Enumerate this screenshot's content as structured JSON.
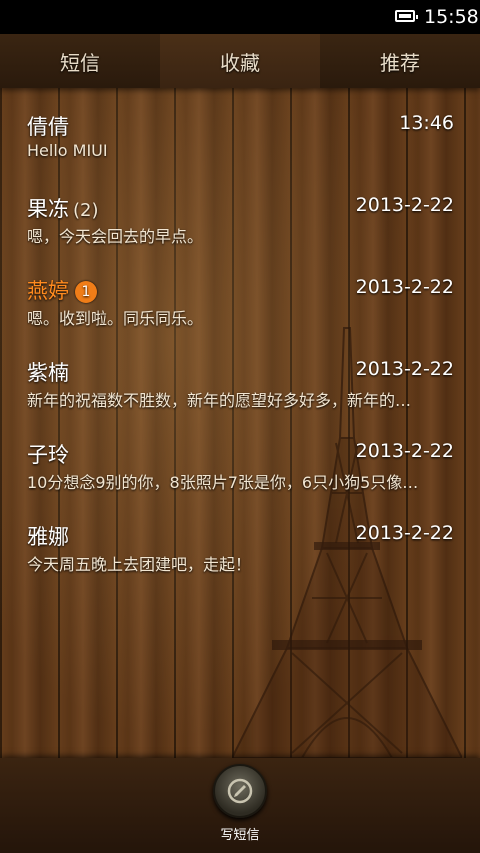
{
  "status_bar": {
    "time": "15:58"
  },
  "tabs": [
    {
      "label": "短信"
    },
    {
      "label": "收藏"
    },
    {
      "label": "推荐"
    }
  ],
  "messages": [
    {
      "name": "倩倩",
      "count": "",
      "unread_badge": "",
      "time": "13:46",
      "preview": "Hello MIUI"
    },
    {
      "name": "果冻",
      "count": "(2)",
      "unread_badge": "",
      "time": "2013-2-22",
      "preview": "嗯，今天会回去的早点。"
    },
    {
      "name": "燕婷",
      "count": "",
      "unread_badge": "1",
      "time": "2013-2-22",
      "preview": "嗯。收到啦。同乐同乐。"
    },
    {
      "name": "紫楠",
      "count": "",
      "unread_badge": "",
      "time": "2013-2-22",
      "preview": "新年的祝福数不胜数，新年的愿望好多好多，新年的…"
    },
    {
      "name": "子玲",
      "count": "",
      "unread_badge": "",
      "time": "2013-2-22",
      "preview": "10分想念9别的你，8张照片7张是你，6只小狗5只像…"
    },
    {
      "name": "雅娜",
      "count": "",
      "unread_badge": "",
      "time": "2013-2-22",
      "preview": "今天周五晚上去团建吧，走起！"
    }
  ],
  "bottom_bar": {
    "compose_label": "写短信"
  },
  "colors": {
    "unread_name": "#ff8a1e",
    "badge": "#f07d18"
  }
}
